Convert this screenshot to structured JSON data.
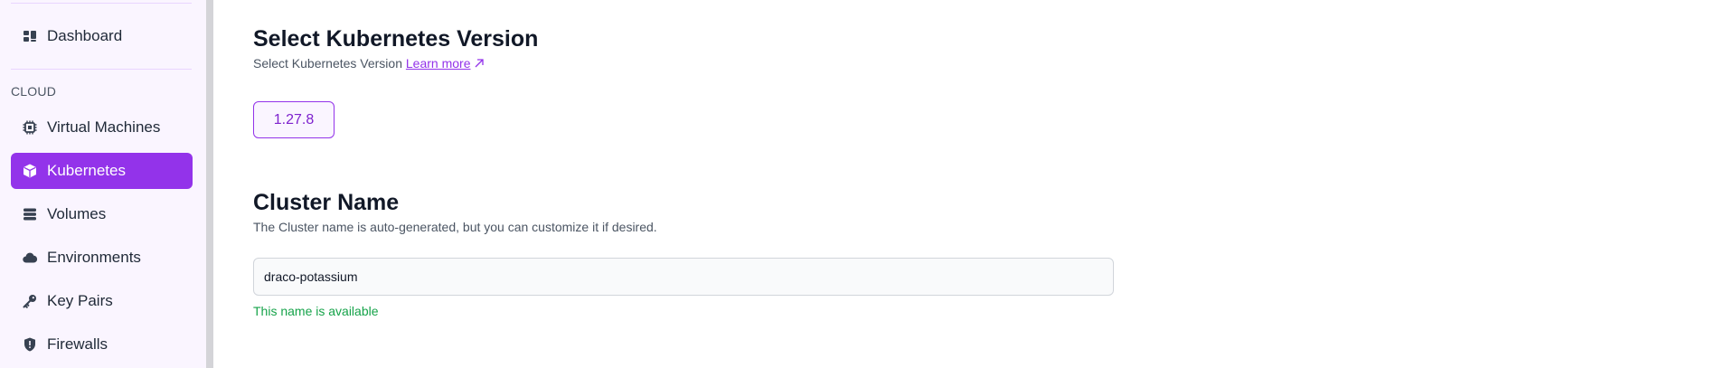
{
  "sidebar": {
    "dashboard": {
      "label": "Dashboard",
      "icon": "dashboard-icon"
    },
    "section_label": "CLOUD",
    "items": [
      {
        "label": "Virtual Machines",
        "icon": "cpu-chip-icon",
        "active": false
      },
      {
        "label": "Kubernetes",
        "icon": "cube-icon",
        "active": true
      },
      {
        "label": "Volumes",
        "icon": "database-stack-icon",
        "active": false
      },
      {
        "label": "Environments",
        "icon": "cloud-icon",
        "active": false
      },
      {
        "label": "Key Pairs",
        "icon": "key-icon",
        "active": false
      },
      {
        "label": "Firewalls",
        "icon": "shield-icon",
        "active": false
      }
    ]
  },
  "version_section": {
    "title": "Select Kubernetes Version",
    "subtitle": "Select Kubernetes Version",
    "learn_more": "Learn more",
    "selected_version": "1.27.8"
  },
  "cluster_section": {
    "title": "Cluster Name",
    "subtitle": "The Cluster name is auto-generated, but you can customize it if desired.",
    "input_value": "draco-potassium",
    "status": "This name is available"
  },
  "colors": {
    "accent": "#9333ea",
    "sidebar_bg": "#faf5ff",
    "success": "#16a34a"
  }
}
